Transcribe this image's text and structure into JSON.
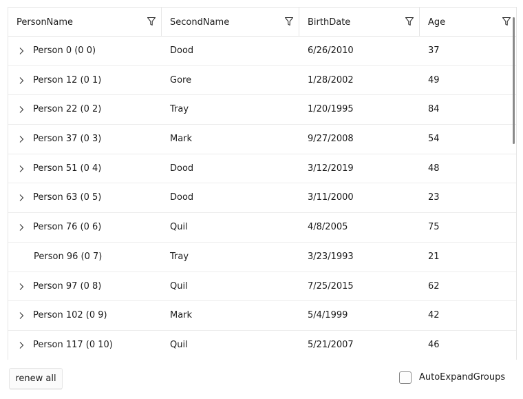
{
  "grid": {
    "columns": [
      {
        "label": "PersonName",
        "icon": "filter-icon"
      },
      {
        "label": "SecondName",
        "icon": "filter-icon"
      },
      {
        "label": "BirthDate",
        "icon": "filter-icon"
      },
      {
        "label": "Age",
        "icon": "filter-icon"
      }
    ],
    "rows": [
      {
        "name": "Person 0 (0 0)",
        "second": "Dood",
        "birth": "6/26/2010",
        "age": "37",
        "expandable": true
      },
      {
        "name": "Person 12 (0 1)",
        "second": "Gore",
        "birth": "1/28/2002",
        "age": "49",
        "expandable": true
      },
      {
        "name": "Person 22 (0 2)",
        "second": "Tray",
        "birth": "1/20/1995",
        "age": "84",
        "expandable": true
      },
      {
        "name": "Person 37 (0 3)",
        "second": "Mark",
        "birth": "9/27/2008",
        "age": "54",
        "expandable": true
      },
      {
        "name": "Person 51 (0 4)",
        "second": "Dood",
        "birth": "3/12/2019",
        "age": "48",
        "expandable": true
      },
      {
        "name": "Person 63 (0 5)",
        "second": "Dood",
        "birth": "3/11/2000",
        "age": "23",
        "expandable": true
      },
      {
        "name": "Person 76 (0 6)",
        "second": "Quil",
        "birth": "4/8/2005",
        "age": "75",
        "expandable": true
      },
      {
        "name": "Person 96 (0 7)",
        "second": "Tray",
        "birth": "3/23/1993",
        "age": "21",
        "expandable": false
      },
      {
        "name": "Person 97 (0 8)",
        "second": "Quil",
        "birth": "7/25/2015",
        "age": "62",
        "expandable": true
      },
      {
        "name": "Person 102 (0 9)",
        "second": "Mark",
        "birth": "5/4/1999",
        "age": "42",
        "expandable": true
      },
      {
        "name": "Person 117 (0 10)",
        "second": "Quil",
        "birth": "5/21/2007",
        "age": "46",
        "expandable": true
      }
    ]
  },
  "footer": {
    "renew_label": "renew all",
    "auto_expand_label": "AutoExpandGroups",
    "auto_expand_checked": false
  },
  "colors": {
    "border": "#e6e6e6",
    "text": "#1b1b1b",
    "scrollbar": "#8a8a8a"
  }
}
